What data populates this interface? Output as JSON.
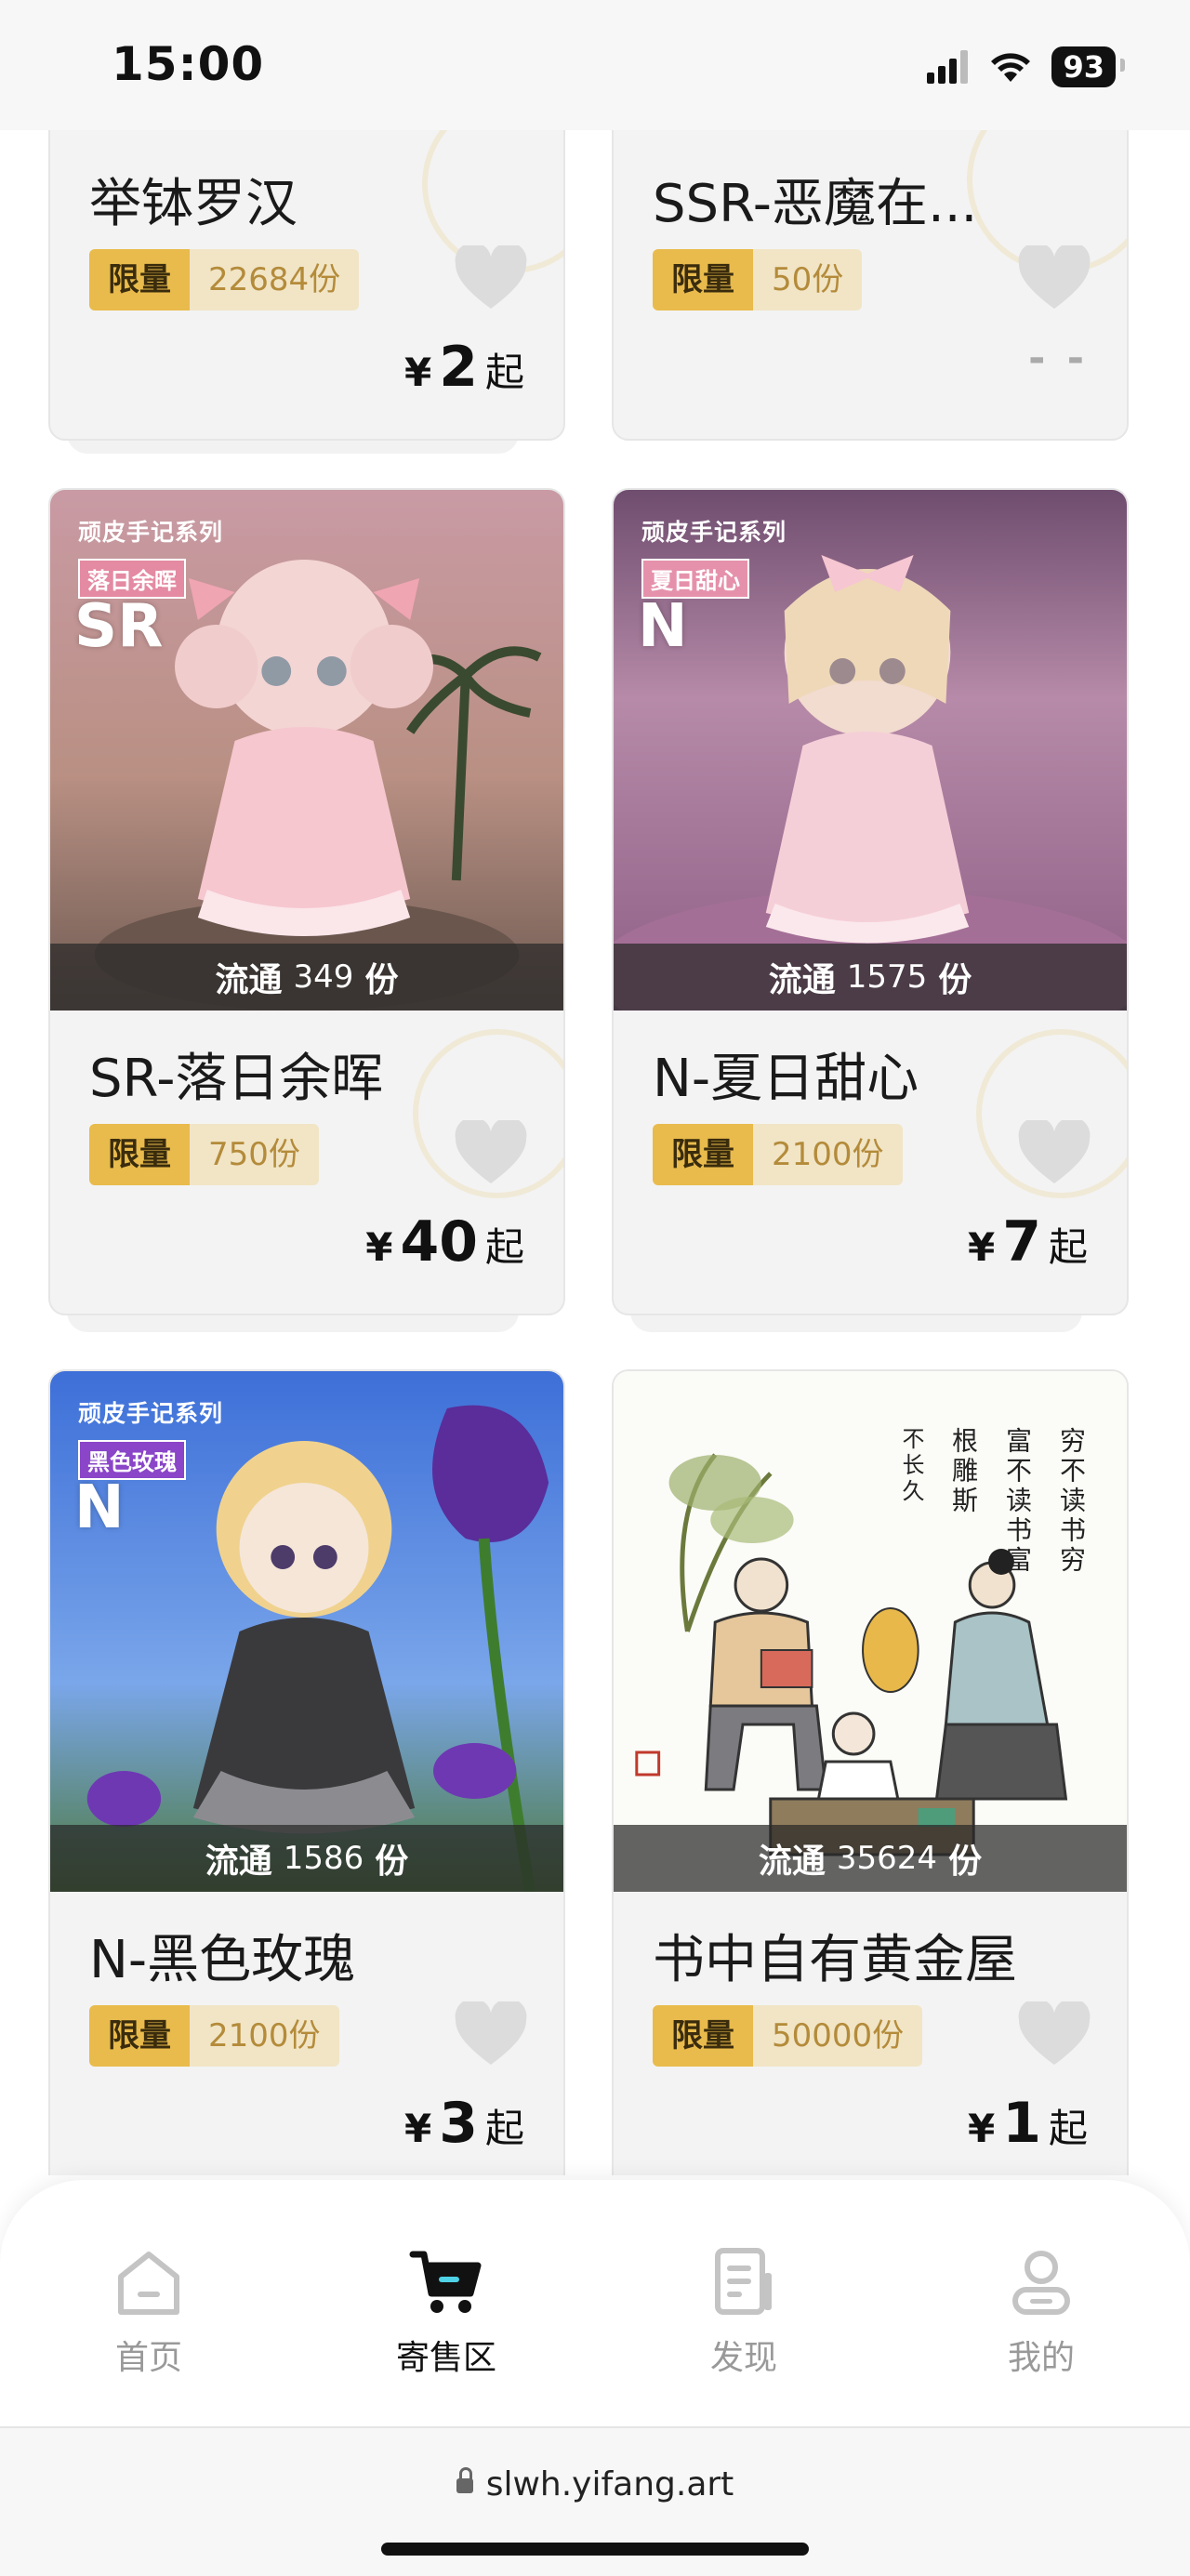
{
  "status_bar": {
    "time": "15:00",
    "battery": "93"
  },
  "items": [
    {
      "name": "举钵罗汉",
      "limit_tag": "限量",
      "limit_qty": "22684份",
      "price_symbol": "¥",
      "price": "2",
      "price_suffix": "起"
    },
    {
      "name": "SSR-恶魔在...",
      "limit_tag": "限量",
      "limit_qty": "50份",
      "price_placeholder": "- -"
    },
    {
      "name": "SR-落日余晖",
      "series": "顽皮手记系列",
      "sub": "落日余晖",
      "rarity": "SR",
      "circ_label": "流通",
      "circ_num": "349",
      "circ_unit": "份",
      "limit_tag": "限量",
      "limit_qty": "750份",
      "price_symbol": "¥",
      "price": "40",
      "price_suffix": "起"
    },
    {
      "name": "N-夏日甜心",
      "series": "顽皮手记系列",
      "sub": "夏日甜心",
      "rarity": "N",
      "circ_label": "流通",
      "circ_num": "1575",
      "circ_unit": "份",
      "limit_tag": "限量",
      "limit_qty": "2100份",
      "price_symbol": "¥",
      "price": "7",
      "price_suffix": "起"
    },
    {
      "name": "N-黑色玫瑰",
      "series": "顽皮手记系列",
      "sub": "黑色玫瑰",
      "rarity": "N",
      "circ_label": "流通",
      "circ_num": "1586",
      "circ_unit": "份",
      "limit_tag": "限量",
      "limit_qty": "2100份",
      "price_symbol": "¥",
      "price": "3",
      "price_suffix": "起"
    },
    {
      "name": "书中自有黄金屋",
      "circ_label": "流通",
      "circ_num": "35624",
      "circ_unit": "份",
      "limit_tag": "限量",
      "limit_qty": "50000份",
      "price_symbol": "¥",
      "price": "1",
      "price_suffix": "起",
      "calligraphy": [
        "穷不读书穷",
        "富不读书富",
        "根雕斯",
        "不长久"
      ]
    }
  ],
  "bottom_nav": [
    {
      "label": "首页",
      "icon": "home-icon",
      "active": false
    },
    {
      "label": "寄售区",
      "icon": "cart-icon",
      "active": true
    },
    {
      "label": "发现",
      "icon": "document-icon",
      "active": false
    },
    {
      "label": "我的",
      "icon": "user-icon",
      "active": false
    }
  ],
  "browser": {
    "url": "slwh.yifang.art"
  },
  "colors": {
    "limit_tag": "#e9bb4c",
    "limit_qty_bg": "#f1e5c6",
    "limit_qty_text": "#b48b3a",
    "card_bg": "#f3f3f3",
    "heart": "#dcdcdc"
  }
}
